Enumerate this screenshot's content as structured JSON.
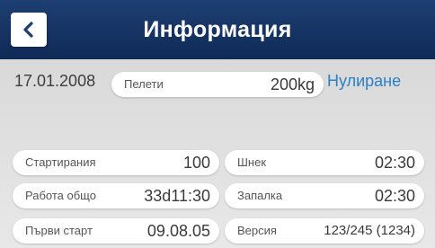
{
  "header": {
    "title": "Информация",
    "back_icon": "chevron-left-icon"
  },
  "summary": {
    "date": "17.01.2008",
    "pellets_label": "Пелети",
    "pellets_value": "200kg",
    "reset_label": "Нулиране"
  },
  "stats": {
    "starts_label": "Стартирания",
    "starts_value": "100",
    "auger_label": "Шнек",
    "auger_value": "02:30",
    "total_work_label": "Работа общо",
    "total_work_value": "33d11:30",
    "ignition_label": "Запалка",
    "ignition_value": "02:30",
    "first_start_label": "Първи старт",
    "first_start_value": "09.08.05",
    "version_label": "Версия",
    "version_value": "123/245 (1234)"
  },
  "colors": {
    "header": "#0e2a56",
    "accent": "#2c7fc4",
    "background": "#e6e6e6"
  }
}
